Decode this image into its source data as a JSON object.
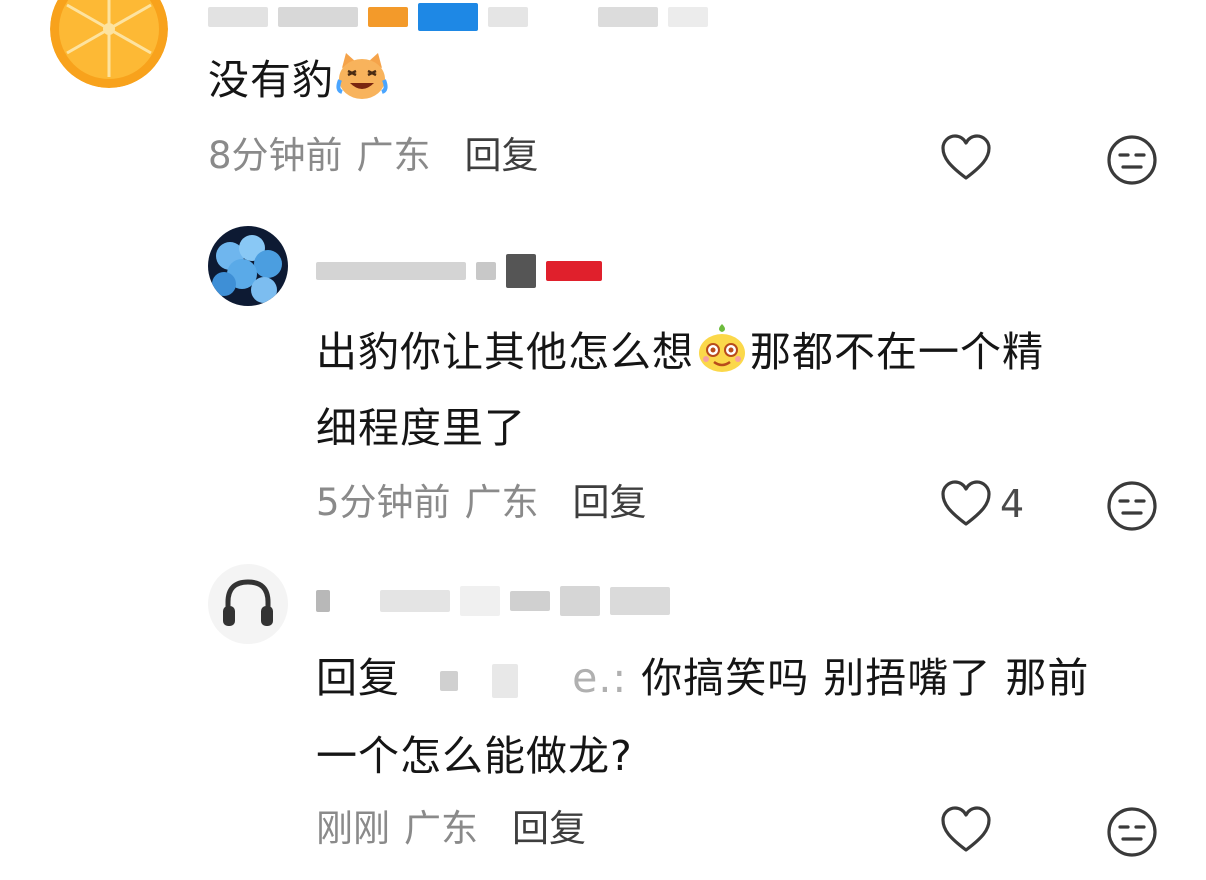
{
  "comments": [
    {
      "text": "没有豹",
      "emoji_icon": "crying-laughing-cat-emoji-icon",
      "time": "8分钟前",
      "location": "广东",
      "reply_label": "回复",
      "like_count": ""
    },
    {
      "text_line1": "出豹你让其他怎么想",
      "emoji_icon": "yellow-pear-mascot-emoji-icon",
      "text_line1_rest": "那都不在一个精",
      "text_line2": "细程度里了",
      "time": "5分钟前",
      "location": "广东",
      "reply_label": "回复",
      "like_count": "4"
    },
    {
      "reply_prefix": "回复",
      "reply_target_visible": "e.:",
      "text_line1": " 你搞笑吗 别捂嘴了 那前",
      "text_line2": "一个怎么能做龙?",
      "time": "刚刚",
      "location": "广东",
      "reply_label": "回复",
      "like_count": ""
    }
  ],
  "colors": {
    "meta_gray": "#8a8a8a",
    "icon_gray": "#3a3a3a",
    "accent_orange": "#f59a23",
    "accent_blue": "#1e88e5"
  }
}
